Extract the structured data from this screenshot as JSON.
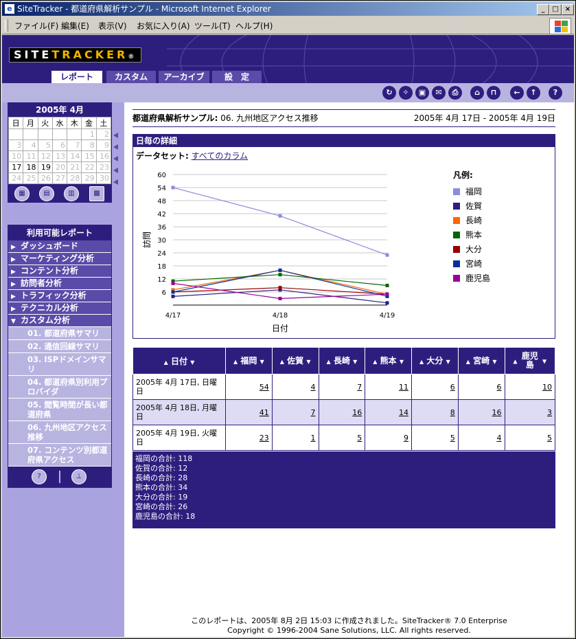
{
  "window": {
    "title": "SiteTracker - 都道府県解析サンプル - Microsoft Internet Explorer",
    "controls": {
      "minimize": "_",
      "maximize": "□",
      "close": "×"
    }
  },
  "menu": [
    "ファイル(F)",
    "編集(E)",
    "表示(V)",
    "お気に入り(A)",
    "ツール(T)",
    "ヘルプ(H)"
  ],
  "brand": {
    "logo_a": "SITE",
    "logo_b": "TRACKER",
    "reg": "®"
  },
  "tabs": [
    "レポート",
    "カスタム",
    "アーカイブ",
    "設　定"
  ],
  "toolbar_icons": [
    "refresh-icon",
    "idea-icon",
    "save-icon",
    "mail-icon",
    "print-icon",
    "home-icon",
    "lock-icon",
    "back-icon",
    "up-icon",
    "help-icon"
  ],
  "calendar": {
    "title": "2005年 4月",
    "weekdays": [
      "日",
      "月",
      "火",
      "水",
      "木",
      "金",
      "土"
    ],
    "weeks": [
      [
        "",
        "",
        "",
        "",
        "",
        "1",
        "2"
      ],
      [
        "3",
        "4",
        "5",
        "6",
        "7",
        "8",
        "9"
      ],
      [
        "10",
        "11",
        "12",
        "13",
        "14",
        "15",
        "16"
      ],
      [
        "17",
        "18",
        "19",
        "20",
        "21",
        "22",
        "23"
      ],
      [
        "24",
        "25",
        "26",
        "27",
        "28",
        "29",
        "30"
      ]
    ],
    "active_days": [
      "17",
      "18",
      "19"
    ]
  },
  "reports": {
    "title": "利用可能レポート",
    "items": [
      "ダッシュボード",
      "マーケティング分析",
      "コンテント分析",
      "訪問者分析",
      "トラフィック分析",
      "テクニカル分析",
      "カスタム分析"
    ],
    "subitems": [
      "01. 都道府県サマリ",
      "02. 通信回線サマリ",
      "03. ISPドメインサマリ",
      "04. 都道府県別利用プロバイダ",
      "05. 閲覧時間が長い都道府県",
      "06. 九州地区アクセス推移",
      "07. コンテンツ別都道府県アクセス"
    ]
  },
  "report": {
    "title_bold": "都道府県解析サンプル:",
    "title_rest": " 06. 九州地区アクセス推移",
    "range": "2005年 4月 17日 - 2005年 4月 19日",
    "panel_title": "日毎の詳細",
    "dataset_label": "データセット:",
    "dataset_link": "すべてのカラム",
    "legend_title": "凡例:",
    "date_header": "日付"
  },
  "chart_data": {
    "type": "line",
    "x": [
      "4/17",
      "4/18",
      "4/19"
    ],
    "xlabel": "日付",
    "ylabel": "訪問",
    "ylim": [
      0,
      60
    ],
    "yticks": [
      6,
      12,
      18,
      24,
      30,
      36,
      42,
      48,
      54,
      60
    ],
    "series": [
      {
        "name": "福岡",
        "values": [
          54,
          41,
          23
        ],
        "color": "#8c8cdc"
      },
      {
        "name": "佐賀",
        "values": [
          4,
          7,
          1
        ],
        "color": "#2d1e7e"
      },
      {
        "name": "長崎",
        "values": [
          7,
          16,
          5
        ],
        "color": "#ff6600"
      },
      {
        "name": "熊本",
        "values": [
          11,
          14,
          9
        ],
        "color": "#006600"
      },
      {
        "name": "大分",
        "values": [
          6,
          8,
          5
        ],
        "color": "#990000"
      },
      {
        "name": "宮崎",
        "values": [
          6,
          16,
          4
        ],
        "color": "#003399"
      },
      {
        "name": "鹿児島",
        "values": [
          10,
          3,
          5
        ],
        "color": "#990099"
      }
    ]
  },
  "table": {
    "rows": [
      {
        "date": "2005年 4月 17日, 日曜日",
        "values": [
          "54",
          "4",
          "7",
          "11",
          "6",
          "6",
          "10"
        ]
      },
      {
        "date": "2005年 4月 18日, 月曜日",
        "values": [
          "41",
          "7",
          "16",
          "14",
          "8",
          "16",
          "3"
        ]
      },
      {
        "date": "2005年 4月 19日, 火曜日",
        "values": [
          "23",
          "1",
          "5",
          "9",
          "5",
          "4",
          "5"
        ]
      }
    ]
  },
  "totals": [
    "福岡の合計: 118",
    "佐賀の合計: 12",
    "長崎の合計: 28",
    "熊本の合計: 34",
    "大分の合計: 19",
    "宮崎の合計: 26",
    "鹿児島の合計: 18"
  ],
  "footer": {
    "line1": "このレポートは、2005年 8月 2日 15:03 に作成されました。SiteTracker® 7.0 Enterprise",
    "line2": "Copyright © 1996-2004 Sane Solutions, LLC. All rights reserved."
  }
}
